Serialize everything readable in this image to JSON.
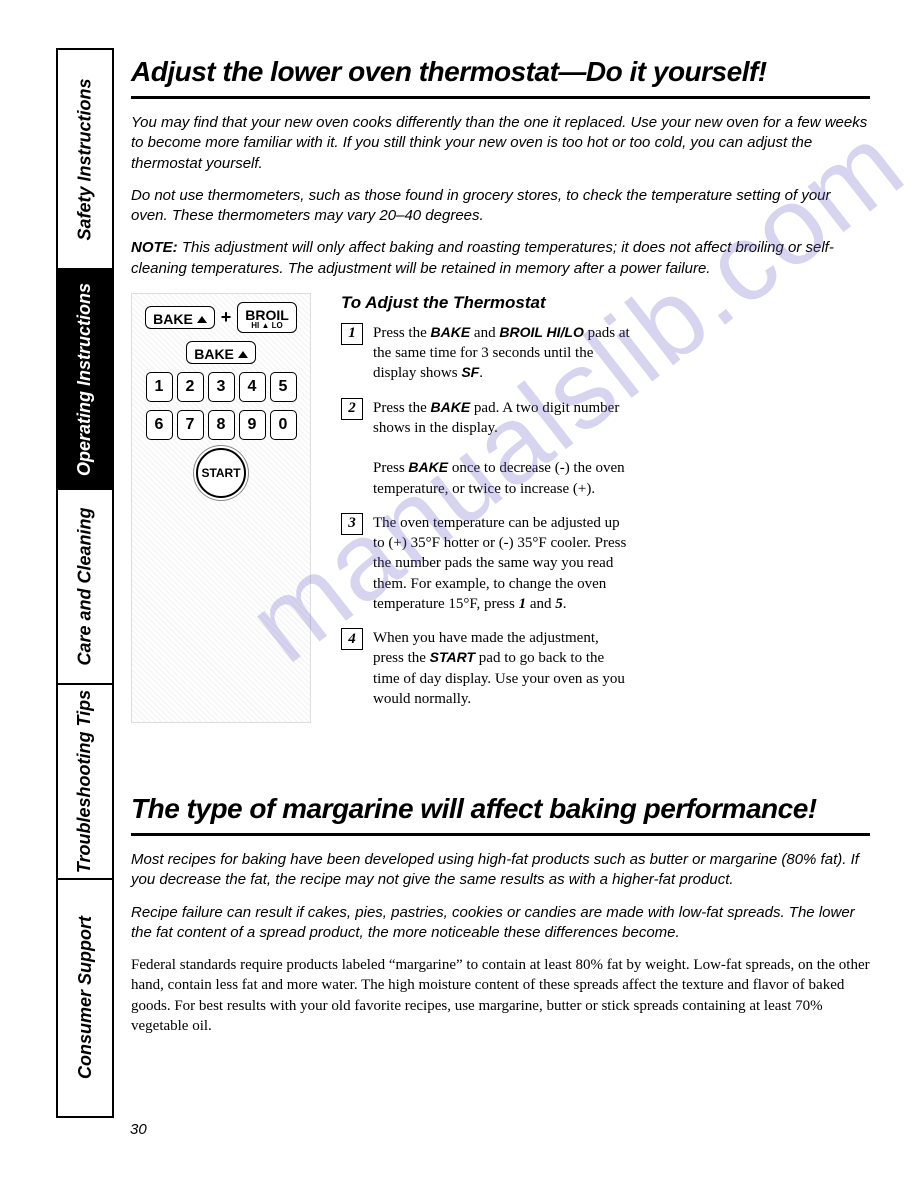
{
  "sidebar": {
    "tabs": [
      {
        "label": "Safety Instructions"
      },
      {
        "label": "Operating Instructions"
      },
      {
        "label": "Care and Cleaning"
      },
      {
        "label": "Troubleshooting Tips"
      },
      {
        "label": "Consumer Support"
      }
    ]
  },
  "section1": {
    "title": "Adjust the lower oven thermostat—Do it yourself!",
    "para1": "You may find that your new oven cooks differently than the one it replaced. Use your new oven for a few weeks to become more familiar with it. If you still think your new oven is too hot or too cold, you can adjust the thermostat yourself.",
    "para2": "Do not use thermometers, such as those found in grocery stores, to check the temperature setting of your oven. These thermometers may vary 20–40 degrees.",
    "note_label": "NOTE:",
    "note_text": " This adjustment will only affect baking and roasting temperatures; it does not affect broiling or self-cleaning temperatures. The adjustment will be retained in memory after a power failure."
  },
  "keypad": {
    "bake": "BAKE",
    "plus": "+",
    "broil": "BROIL",
    "broil_sub": "HI ▲ LO",
    "bake2": "BAKE",
    "nums_row1": [
      "1",
      "2",
      "3",
      "4",
      "5"
    ],
    "nums_row2": [
      "6",
      "7",
      "8",
      "9",
      "0"
    ],
    "start": "START"
  },
  "steps": {
    "title": "To Adjust the Thermostat",
    "items": [
      {
        "n": "1",
        "pre": "Press the ",
        "b1": "BAKE",
        "mid": " and ",
        "b2": "BROIL HI/LO",
        "post": " pads at the same time for 3 seconds until the display shows ",
        "b3": "SF",
        "end": "."
      },
      {
        "n": "2",
        "pre": "Press the ",
        "b1": "BAKE",
        "post": " pad. A two digit number shows in the display.",
        "extra_pre": "Press ",
        "extra_b": "BAKE",
        "extra_post": " once to decrease (-) the oven temperature, or twice to increase (+)."
      },
      {
        "n": "3",
        "text": "The oven temperature can be adjusted up to (+) 35°F hotter or (-) 35°F cooler. Press the number pads the same way you read them. For example, to change the oven temperature 15°F, press ",
        "n1": "1",
        "mid": " and ",
        "n2": "5",
        "end": "."
      },
      {
        "n": "4",
        "pre": "When you have made the adjustment, press the ",
        "b1": "START",
        "post": " pad to go back to the time of day display. Use your oven as you would normally."
      }
    ]
  },
  "section2": {
    "title": "The type of margarine will affect baking performance!",
    "para1": "Most recipes for baking have been developed using high-fat products such as butter or margarine (80% fat). If you decrease the fat, the recipe may not give the same results as with a higher-fat product.",
    "para2": "Recipe failure can result if cakes, pies, pastries, cookies or candies are made with low-fat spreads. The lower the fat content of a spread product, the more noticeable these differences become.",
    "para3": "Federal standards require products labeled “margarine” to contain at least 80% fat by weight. Low-fat spreads, on the other hand, contain less fat and more water. The high moisture content of these spreads affect the texture and flavor of baked goods. For best results with your old favorite recipes, use margarine, butter or stick spreads containing at least 70% vegetable oil."
  },
  "page_number": "30",
  "watermark": "manualslib.com"
}
